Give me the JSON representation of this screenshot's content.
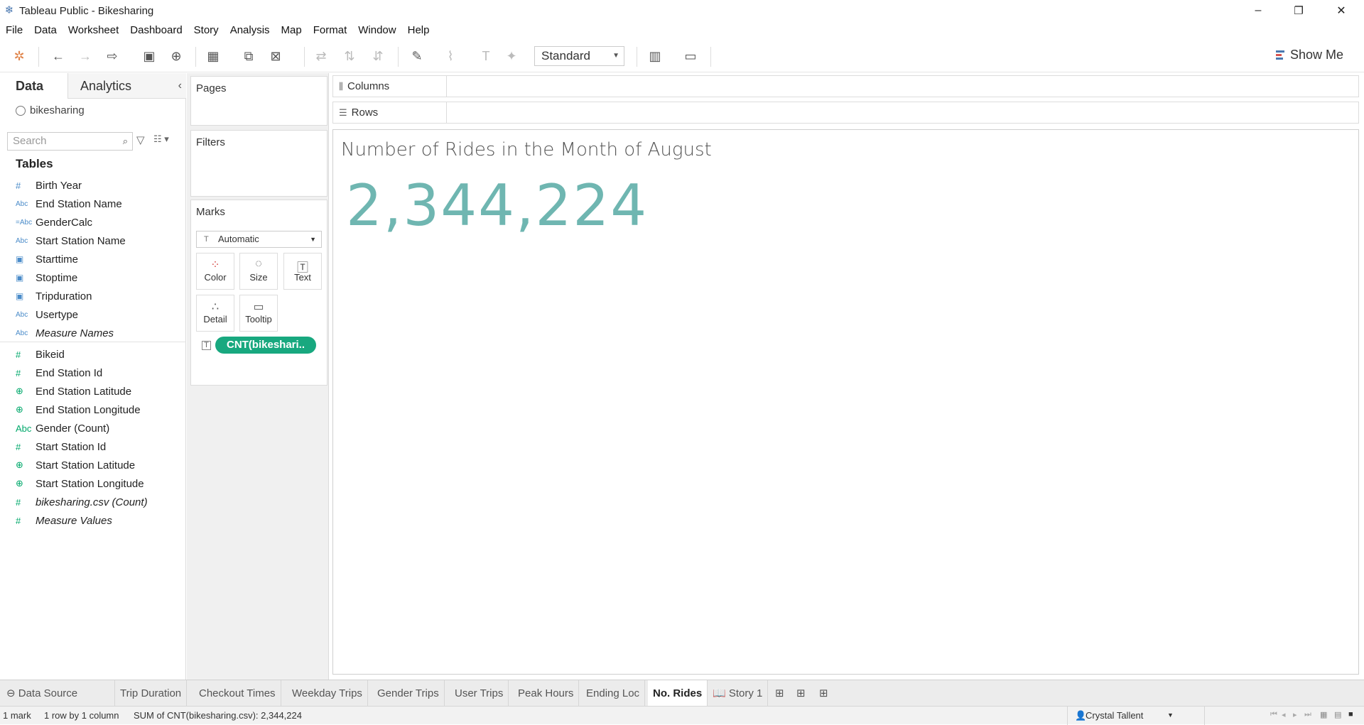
{
  "window": {
    "title": "Tableau Public - Bikesharing",
    "minimize": "–",
    "restore": "❐",
    "close": "✕"
  },
  "menu": [
    "File",
    "Data",
    "Worksheet",
    "Dashboard",
    "Story",
    "Analysis",
    "Map",
    "Format",
    "Window",
    "Help"
  ],
  "toolbar": {
    "fit_value": "Standard",
    "show_me_label": "Show Me"
  },
  "data_pane": {
    "tab_data": "Data",
    "tab_analytics": "Analytics",
    "data_source": "bikesharing",
    "search_placeholder": "Search",
    "tables_heading": "Tables",
    "dimensions": [
      {
        "icon": "#",
        "label": "Birth Year",
        "italic": false
      },
      {
        "icon": "Abc",
        "label": "End Station Name",
        "italic": false
      },
      {
        "icon": "=Abc",
        "label": "GenderCalc",
        "italic": false
      },
      {
        "icon": "Abc",
        "label": "Start Station Name",
        "italic": false
      },
      {
        "icon": "cal",
        "label": "Starttime",
        "italic": false
      },
      {
        "icon": "cal",
        "label": "Stoptime",
        "italic": false
      },
      {
        "icon": "cal",
        "label": "Tripduration",
        "italic": false
      },
      {
        "icon": "Abc",
        "label": "Usertype",
        "italic": false
      },
      {
        "icon": "Abc",
        "label": "Measure Names",
        "italic": true
      }
    ],
    "measures": [
      {
        "icon": "#",
        "label": "Bikeid",
        "italic": false
      },
      {
        "icon": "#",
        "label": "End Station Id",
        "italic": false
      },
      {
        "icon": "globe",
        "label": "End Station Latitude",
        "italic": false
      },
      {
        "icon": "globe",
        "label": "End Station Longitude",
        "italic": false
      },
      {
        "icon": "Abc",
        "label": "Gender (Count)",
        "italic": false
      },
      {
        "icon": "#",
        "label": "Start Station Id",
        "italic": false
      },
      {
        "icon": "globe",
        "label": "Start Station Latitude",
        "italic": false
      },
      {
        "icon": "globe",
        "label": "Start Station Longitude",
        "italic": false
      },
      {
        "icon": "#",
        "label": "bikesharing.csv (Count)",
        "italic": true
      },
      {
        "icon": "#",
        "label": "Measure Values",
        "italic": true
      }
    ]
  },
  "shelves": {
    "pages": "Pages",
    "filters": "Filters",
    "marks": "Marks",
    "mark_type": "Automatic",
    "color": "Color",
    "size": "Size",
    "text": "Text",
    "detail": "Detail",
    "tooltip": "Tooltip",
    "pill": "CNT(bikeshari..",
    "columns": "Columns",
    "rows": "Rows"
  },
  "view": {
    "title": "Number of Rides in the Month of August",
    "value": "2,344,224",
    "value_color": "#6fb6b1"
  },
  "sheets": [
    "Data Source",
    "Trip Duration",
    "Checkout Times",
    "Weekday Trips",
    "Gender Trips",
    "User Trips",
    "Peak Hours",
    "Ending Loc",
    "No. Rides",
    "Story 1"
  ],
  "active_sheet": "No. Rides",
  "status": {
    "marks": "1 mark",
    "dims": "1 row by 1 column",
    "sum": "SUM of CNT(bikesharing.csv): 2,344,224",
    "user": "Crystal Tallent"
  },
  "colors": {
    "accent_pill": "#18a87f",
    "measure_icon": "#00a86b",
    "dimension_icon": "#4a8bc9"
  }
}
